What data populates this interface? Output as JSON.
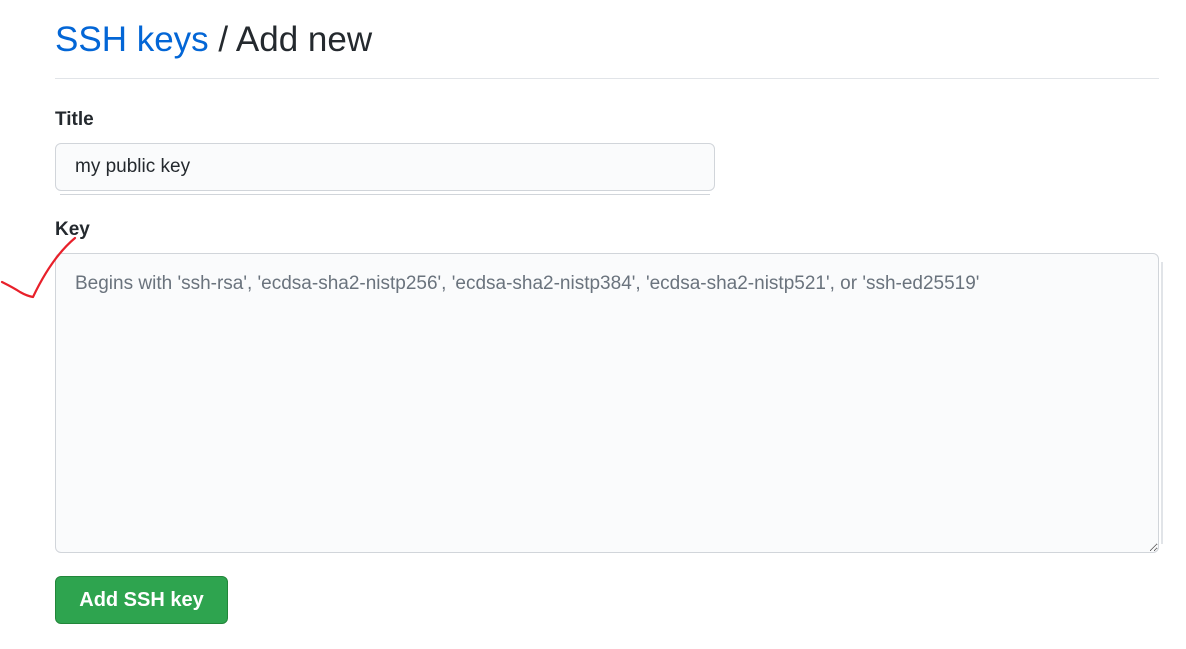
{
  "header": {
    "link_label": "SSH keys",
    "separator": " / ",
    "current_label": "Add new"
  },
  "form": {
    "title_label": "Title",
    "title_value": "my public key",
    "key_label": "Key",
    "key_placeholder": "Begins with 'ssh-rsa', 'ecdsa-sha2-nistp256', 'ecdsa-sha2-nistp384', 'ecdsa-sha2-nistp521', or 'ssh-ed25519'",
    "key_value": "",
    "submit_label": "Add SSH key"
  },
  "annotation": {
    "icon": "red-checkmark-annotation",
    "color": "#e8202a"
  },
  "colors": {
    "link": "#0366d6",
    "primary_button": "#2ea44f"
  }
}
